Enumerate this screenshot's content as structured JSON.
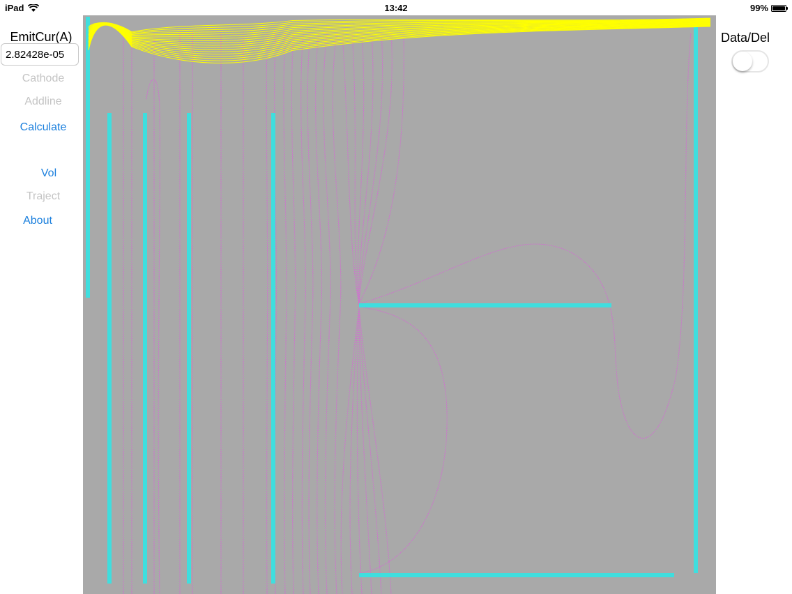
{
  "status": {
    "device": "iPad",
    "time": "13:42",
    "battery": "99%",
    "battery_level": 0.99,
    "wifi_icon": "wifi-icon"
  },
  "sidebar": {
    "emit_label": "EmitCur(A)",
    "emit_value": "2.82428e-05",
    "items": [
      {
        "label": "Cathode",
        "enabled": false
      },
      {
        "label": "Addline",
        "enabled": false
      },
      {
        "label": "Calculate",
        "enabled": true
      },
      {
        "label": "Vol",
        "enabled": true
      },
      {
        "label": "Traject",
        "enabled": false
      },
      {
        "label": "About",
        "enabled": true
      }
    ]
  },
  "right": {
    "data_label": "Data/Del",
    "toggle_on": false
  },
  "colors": {
    "canvas_bg": "#a9a9a9",
    "electrode": "#3fdede",
    "trajectory": "#ffff00",
    "equipotential": "#d070d0",
    "enabled_button": "#1a7fdd",
    "disabled_button": "#c4c4c4"
  }
}
